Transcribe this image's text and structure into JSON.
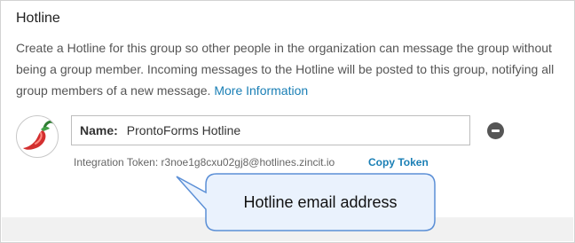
{
  "section": {
    "title": "Hotline",
    "description": "Create a Hotline for this group so other people in the organization can message the group without being a group member. Incoming messages to the Hotline will be posted to this group, notifying all group members of a new message.",
    "more_info_link": "More Information"
  },
  "hotline": {
    "avatar_icon": "chili-pepper-icon",
    "name_label": "Name:",
    "name_value": "ProntoForms Hotline",
    "token_label": "Integration Token:",
    "token_value": "r3noe1g8cxu02gj8@hotlines.zincit.io",
    "copy_token_label": "Copy Token",
    "remove_icon": "minus-circle-icon"
  },
  "annotation": {
    "callout_text": "Hotline email address"
  },
  "colors": {
    "link": "#1a7fb5",
    "callout_border": "#5b8fd6",
    "callout_fill": "#eaf2fd",
    "remove_button": "#555555"
  }
}
